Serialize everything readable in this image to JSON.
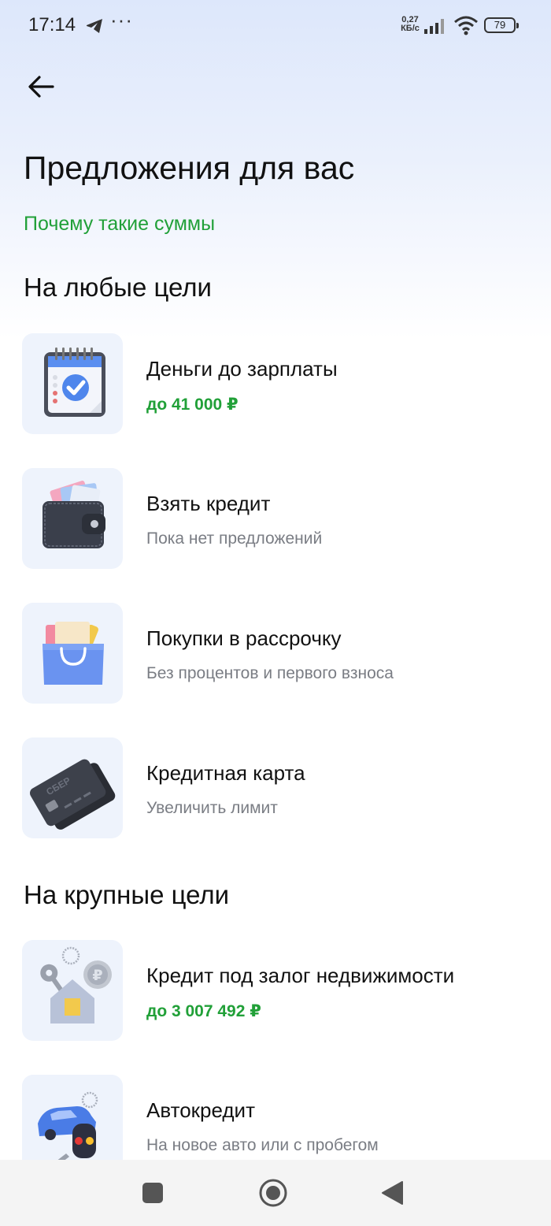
{
  "status_bar": {
    "time": "17:14",
    "net_speed_value": "0,27",
    "net_speed_unit": "КБ/с",
    "battery": "79",
    "more_indicator": "···"
  },
  "header": {
    "title": "Предложения для вас",
    "why_link": "Почему такие суммы"
  },
  "sections": [
    {
      "title": "На любые цели",
      "items": [
        {
          "title": "Деньги до зарплаты",
          "subtitle": "до 41 000 ₽",
          "icon": "calendar-check-icon"
        },
        {
          "title": "Взять кредит",
          "subtitle": "Пока нет предложений",
          "icon": "wallet-icon"
        },
        {
          "title": "Покупки в рассрочку",
          "subtitle": "Без процентов и первого взноса",
          "icon": "shopping-bag-icon"
        },
        {
          "title": "Кредитная карта",
          "subtitle": "Увеличить лимит",
          "icon": "credit-card-icon"
        }
      ]
    },
    {
      "title": "На крупные цели",
      "items": [
        {
          "title": "Кредит под залог недвижимости",
          "subtitle": "до 3 007 492 ₽",
          "icon": "house-keys-icon"
        },
        {
          "title": "Автокредит",
          "subtitle": "На новое авто или с пробегом",
          "icon": "car-key-icon"
        }
      ]
    }
  ],
  "card_brand": "СБЕР",
  "colors": {
    "accent_green": "#21a038",
    "secondary_text": "#7a7d84",
    "thumb_bg": "#eef3fc"
  }
}
